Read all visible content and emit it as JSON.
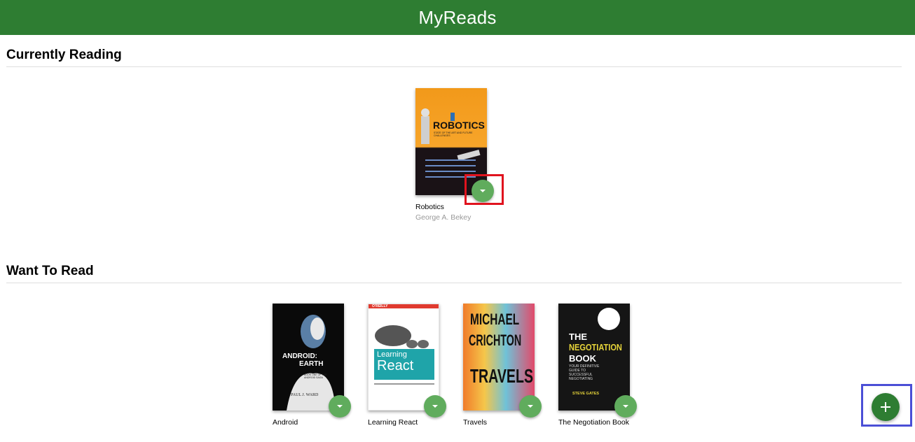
{
  "app": {
    "title": "MyReads"
  },
  "colors": {
    "header_bg": "#2e7d32",
    "changer_bg": "#60ac5d",
    "add_button_bg": "#2e7d32",
    "annotation_red": "#e0131e",
    "annotation_blue": "#4b4fd6"
  },
  "shelves": [
    {
      "title": "Currently Reading",
      "books": [
        {
          "title": "Robotics",
          "authors": "George A. Bekey",
          "cover": {
            "title": "ROBOTICS",
            "subtitle": "STATE OF THE ART AND FUTURE CHALLENGES"
          }
        }
      ]
    },
    {
      "title": "Want To Read",
      "books": [
        {
          "title": "Android",
          "authors": "",
          "cover": {
            "title_line1": "ANDROID:",
            "title_line2": "EARTH",
            "subtitle": "BOOK ONE OF THE ANDROID SAGA",
            "author": "PAUL J. WARD"
          }
        },
        {
          "title": "Learning React",
          "authors": "",
          "cover": {
            "publisher": "O'REILLY",
            "title_line1": "Learning",
            "title_line2": "React"
          }
        },
        {
          "title": "Travels",
          "authors": "",
          "cover": {
            "line1": "MICHAEL",
            "line2": "CRICHTON",
            "line3": "TRAVELS"
          }
        },
        {
          "title": "The Negotiation Book",
          "authors": "",
          "cover": {
            "line1": "THE",
            "line2": "NEGOTIATION",
            "line3": "BOOK",
            "tagline": "YOUR DEFINITIVE GUIDE TO SUCCESSFUL NEGOTIATING",
            "author": "STEVE GATES"
          }
        }
      ]
    }
  ],
  "icons": {
    "changer": "triangle-down-icon",
    "add": "plus-icon"
  }
}
